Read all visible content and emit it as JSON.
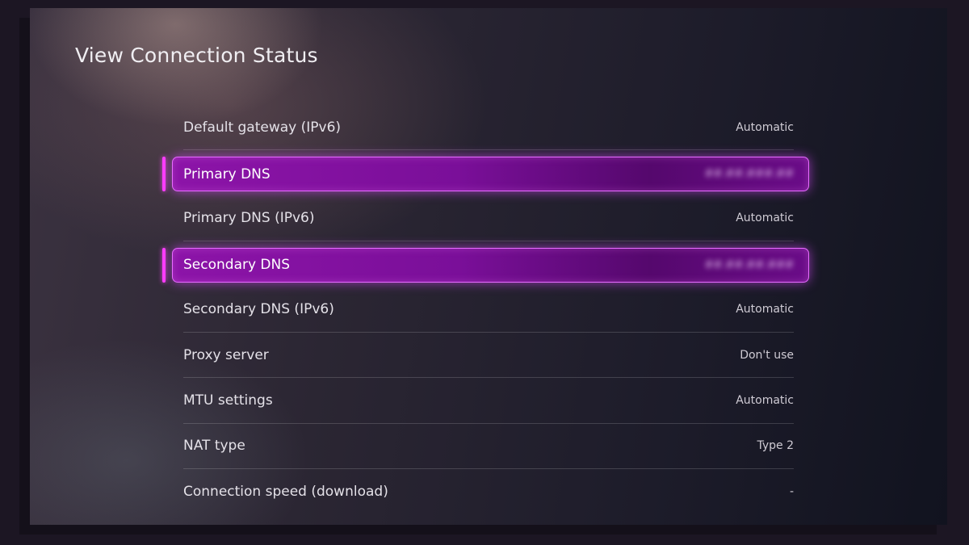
{
  "page": {
    "title": "View Connection Status"
  },
  "items": [
    {
      "label": "Default gateway (IPv6)",
      "value": "Automatic",
      "selected": false
    },
    {
      "label": "Primary DNS",
      "value": "##.##.###.##",
      "selected": true
    },
    {
      "label": "Primary DNS (IPv6)",
      "value": "Automatic",
      "selected": false
    },
    {
      "label": "Secondary DNS",
      "value": "##.##.##.###",
      "selected": true
    },
    {
      "label": "Secondary DNS (IPv6)",
      "value": "Automatic",
      "selected": false
    },
    {
      "label": "Proxy server",
      "value": "Don't use",
      "selected": false
    },
    {
      "label": "MTU settings",
      "value": "Automatic",
      "selected": false
    },
    {
      "label": "NAT type",
      "value": "Type 2",
      "selected": false
    },
    {
      "label": "Connection speed (download)",
      "value": "-",
      "selected": false
    }
  ],
  "colors": {
    "accent": "#e76cff",
    "highlight_fill": "#7a0f99",
    "background": "#2b2633"
  }
}
